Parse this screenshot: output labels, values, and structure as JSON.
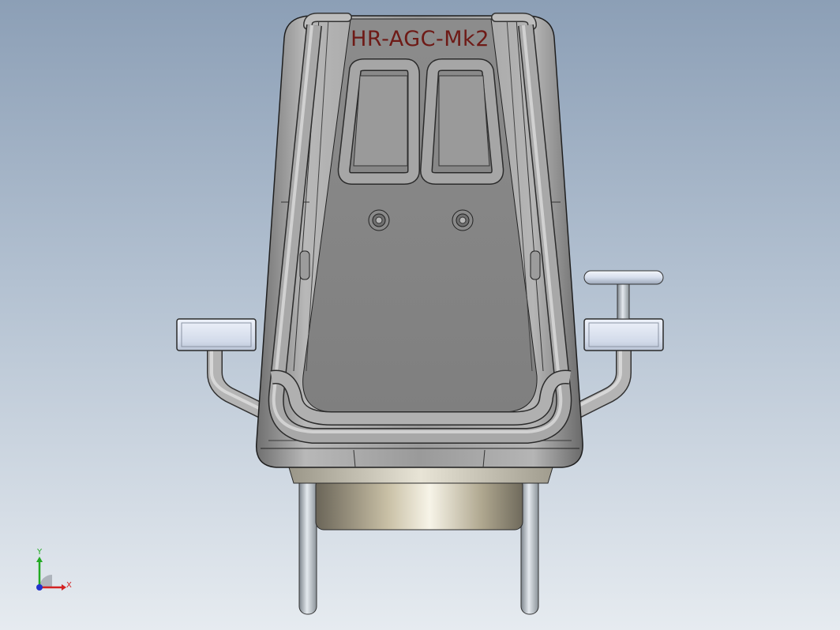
{
  "viewport": {
    "background_top": "#8c9fb6",
    "background_bottom": "#e6ebf0"
  },
  "model": {
    "seat_label": "HR-AGC-Mk2",
    "label_color": "#6e1a16",
    "body_color": "#8c8c8c",
    "tube_color": "#a8a8a8",
    "handle_color": "#d9e1ee"
  },
  "triad": {
    "x_label": "X",
    "y_label": "Y",
    "x_color": "#d32222",
    "y_color": "#22aa22",
    "z_color": "#2233cc"
  }
}
